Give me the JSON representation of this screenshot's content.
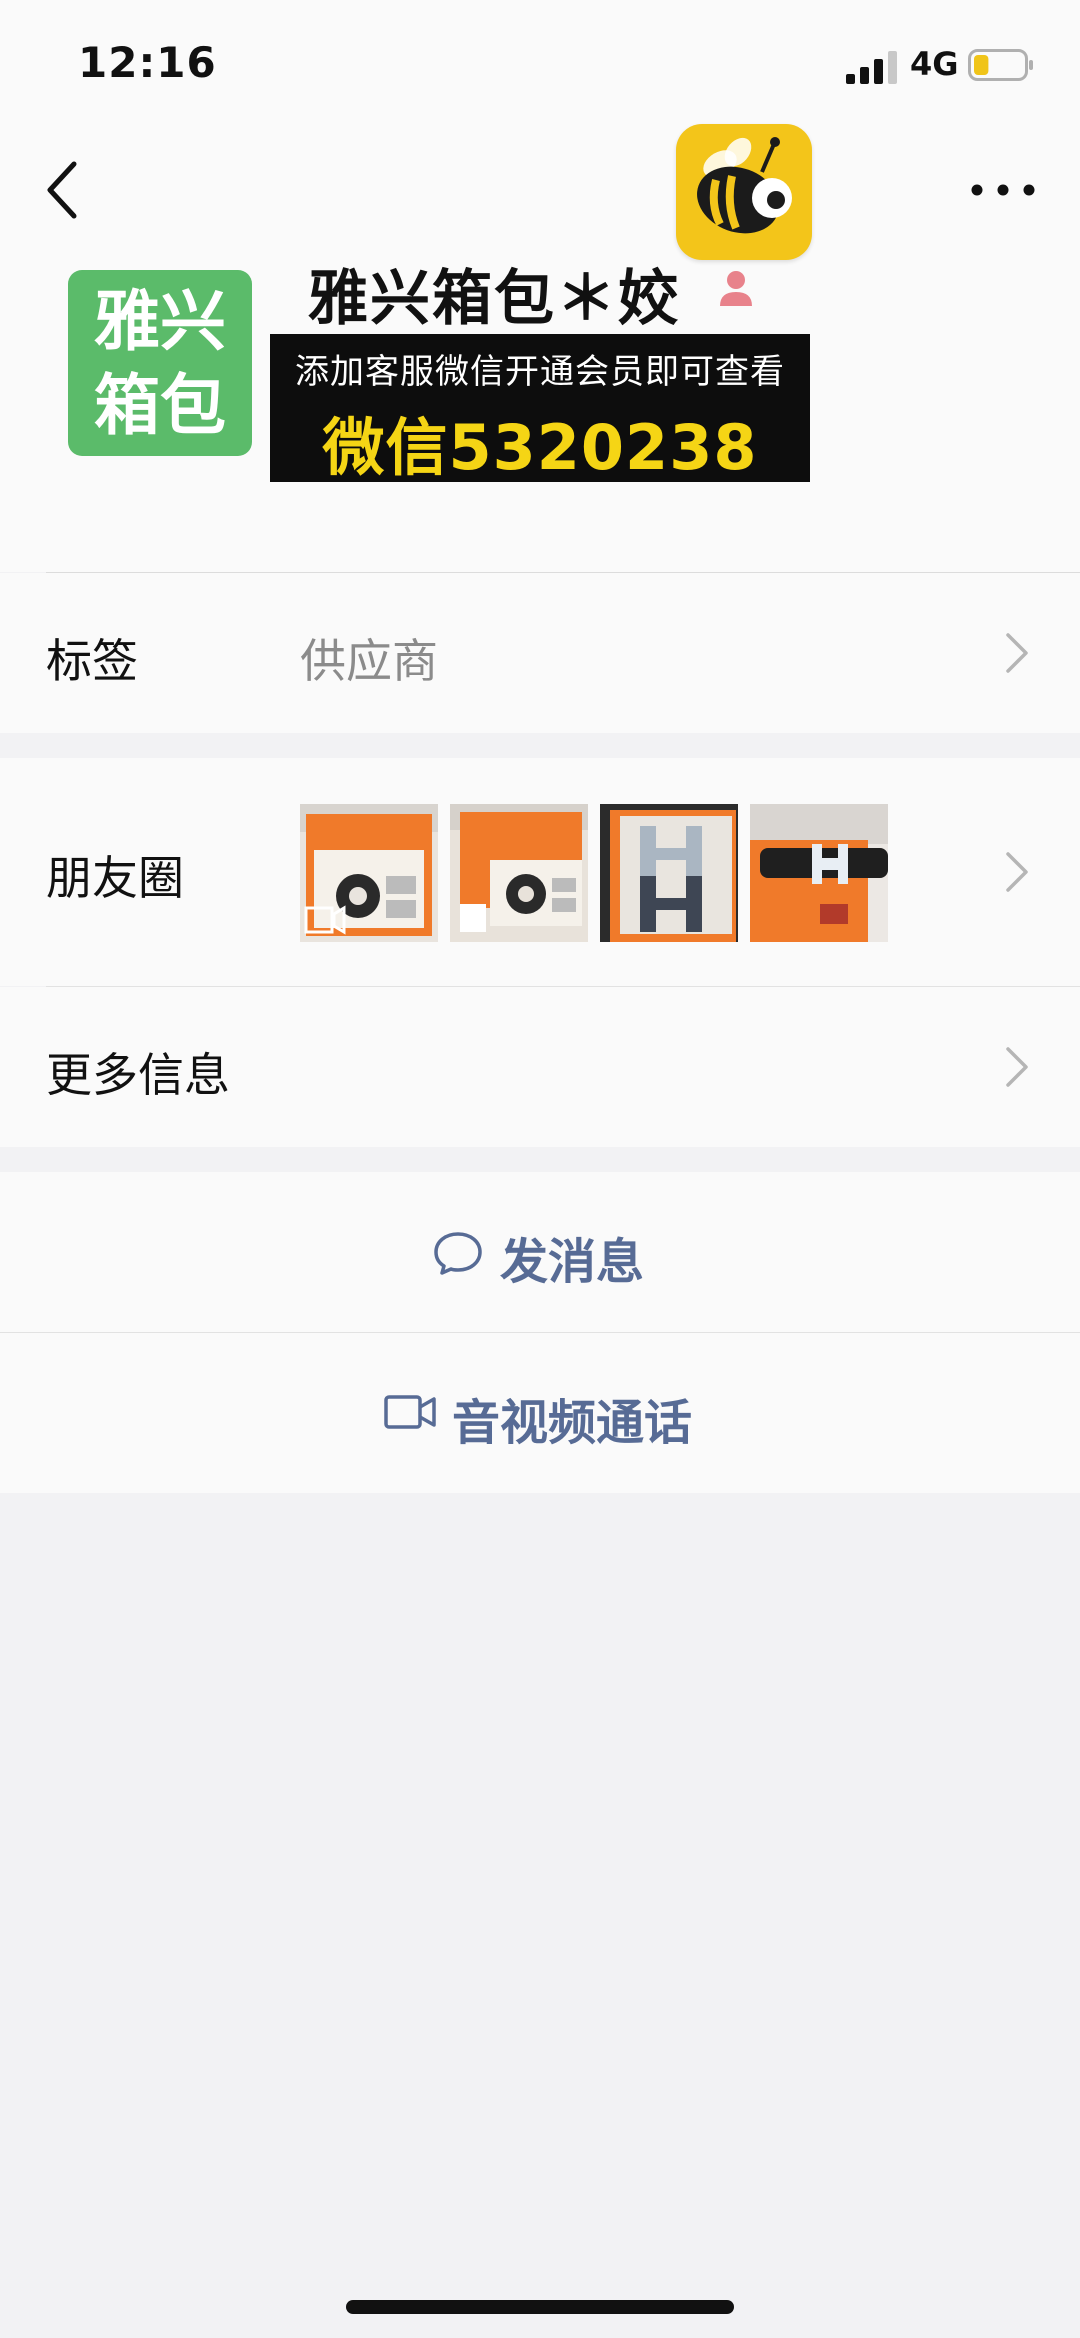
{
  "status_bar": {
    "time": "12:16",
    "network": "4G",
    "battery_level": 0.3,
    "battery_color": "#f0c419"
  },
  "header": {
    "back_icon": "chevron-left-icon",
    "more_icon": "more-dots-icon",
    "badge_app_icon": "bee-app-icon",
    "avatar_line1": "雅兴",
    "avatar_line2": "箱包",
    "avatar_color": "#5bbb6a",
    "name": "雅兴箱包＊姣",
    "gender_icon": "female-icon",
    "promo_line1": "添加客服微信开通会员即可查看",
    "promo_line2": "微信5320238",
    "promo_text_color": "#f5d515"
  },
  "rows": {
    "tag_label": "标签",
    "tag_value": "供应商",
    "moments_label": "朋友圈",
    "more_info_label": "更多信息"
  },
  "actions": {
    "message_label": "发消息",
    "call_label": "音视频通话",
    "link_color": "#576b95"
  }
}
